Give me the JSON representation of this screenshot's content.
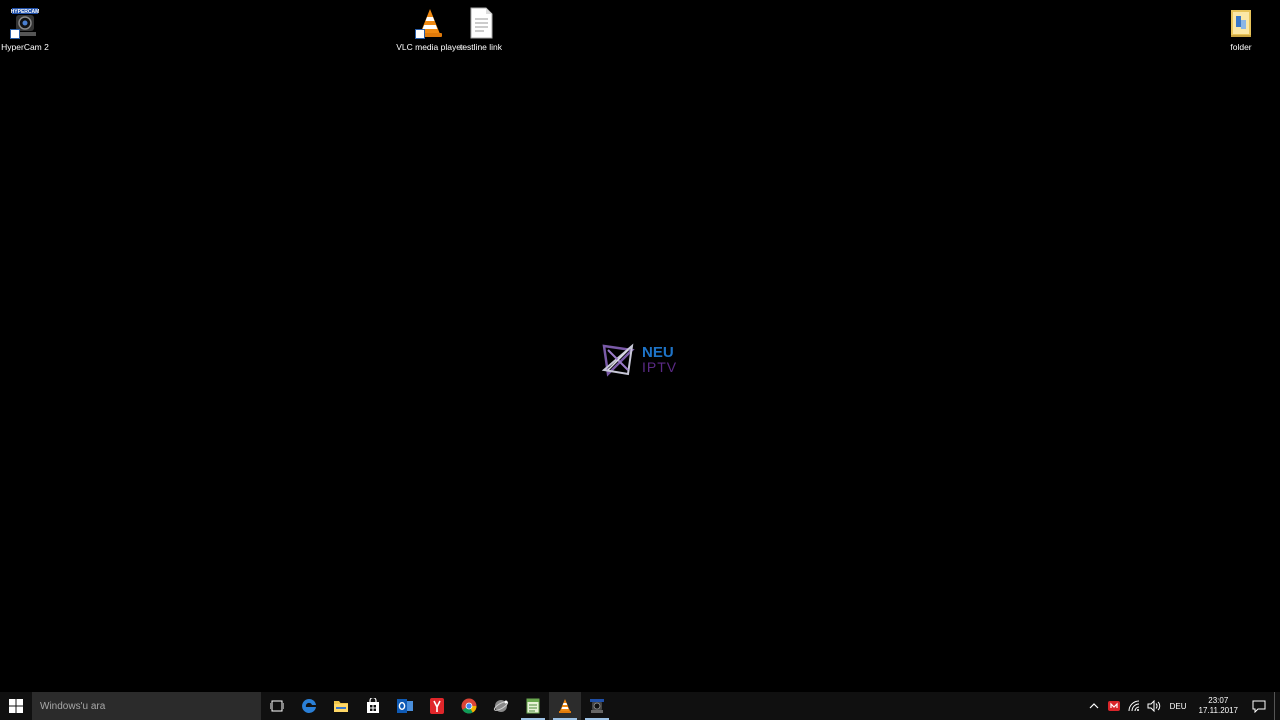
{
  "desktop": {
    "icons": [
      {
        "label": "HyperCam 2",
        "icon": "hypercam-icon"
      },
      {
        "label": "VLC media player",
        "icon": "vlc-cone-icon"
      },
      {
        "label": "testline link",
        "icon": "text-file-icon"
      },
      {
        "label": "folder",
        "icon": "folder-icon"
      }
    ],
    "wallpaper_logo": {
      "line1": "NEU",
      "line2": "IPTV"
    }
  },
  "taskbar": {
    "search_placeholder": "Windows'u ara",
    "apps": [
      {
        "name": "task-view",
        "icon": "task-view-icon"
      },
      {
        "name": "edge",
        "icon": "edge-icon"
      },
      {
        "name": "file-explorer",
        "icon": "folder-icon"
      },
      {
        "name": "store",
        "icon": "store-icon"
      },
      {
        "name": "outlook",
        "icon": "outlook-icon"
      },
      {
        "name": "yandex",
        "icon": "yandex-icon"
      },
      {
        "name": "chrome",
        "icon": "chrome-icon"
      },
      {
        "name": "utility",
        "icon": "satellite-icon"
      },
      {
        "name": "notepad",
        "icon": "notepad-icon"
      },
      {
        "name": "vlc",
        "icon": "vlc-cone-icon"
      },
      {
        "name": "hypercam",
        "icon": "hypercam-icon"
      }
    ],
    "tray": {
      "language": "DEU",
      "time": "23:07",
      "date": "17.11.2017"
    }
  },
  "colors": {
    "desktop_bg": "#000000",
    "taskbar_bg": "#101010",
    "search_bg": "#2b2b2b",
    "accent_blue": "#1e74c8",
    "logo_purple": "#5b2a86"
  }
}
